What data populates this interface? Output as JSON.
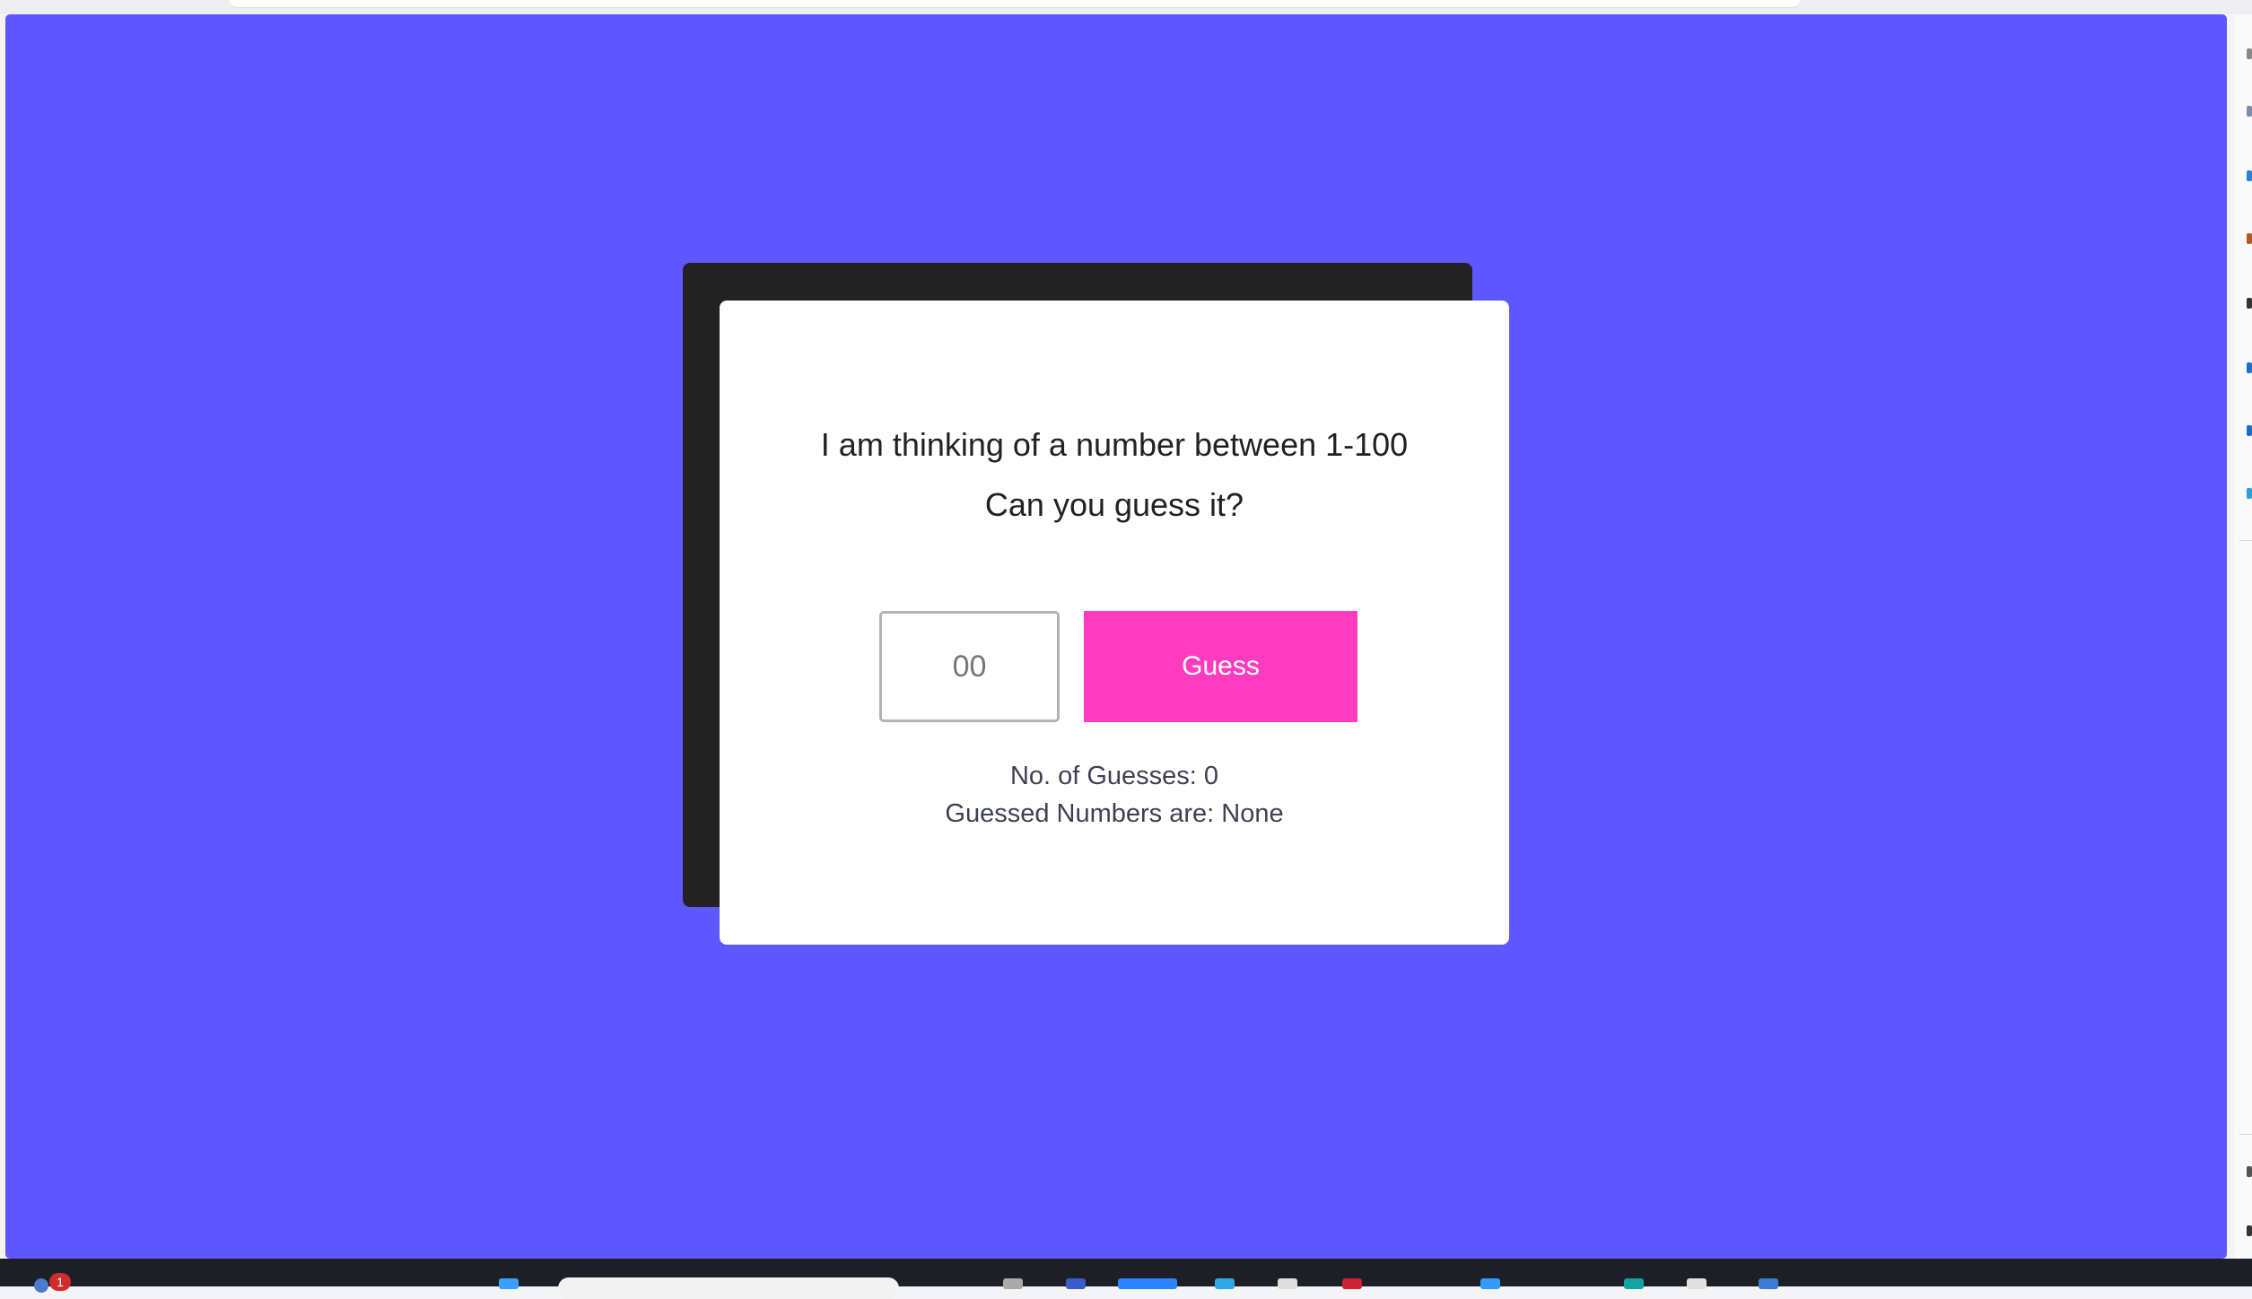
{
  "game": {
    "prompt_line_1": "I am thinking of a number between 1-100",
    "prompt_line_2": "Can you guess it?",
    "input": {
      "placeholder": "00",
      "value": ""
    },
    "guess_button_label": "Guess",
    "guesses_count_text": "No. of Guesses: 0",
    "guessed_numbers_text": "Guessed Numbers are: None"
  },
  "taskbar": {
    "notification_count": "1"
  },
  "colors": {
    "background": "#5e57ff",
    "card": "#ffffff",
    "card_shadow": "#222222",
    "button": "#ff3bbf",
    "text": "#222222",
    "info_text": "#3f4152"
  },
  "icons": {
    "weather": "weather-icon",
    "search": "taskbar-search-icon"
  }
}
